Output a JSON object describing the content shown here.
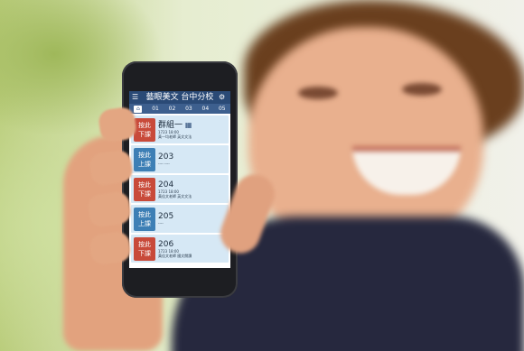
{
  "app": {
    "title": "藝眼美文 台中分校",
    "tabs": [
      "01",
      "02",
      "03",
      "04",
      "05"
    ],
    "rooms": [
      {
        "action_line1": "按此",
        "action_line2": "下課",
        "status": "in-use",
        "room": "群組一",
        "meta_line1": "1723   18:00",
        "meta_line2": "黃一均老師    英文文法"
      },
      {
        "action_line1": "按此",
        "action_line2": "上課",
        "status": "free",
        "room": "203",
        "meta_line1": "----    ----",
        "meta_line2": ""
      },
      {
        "action_line1": "按此",
        "action_line2": "下課",
        "status": "in-use",
        "room": "204",
        "meta_line1": "1723   18:00",
        "meta_line2": "黃佳文老師    英文文法"
      },
      {
        "action_line1": "按此",
        "action_line2": "上課",
        "status": "free",
        "room": "205",
        "meta_line1": "----",
        "meta_line2": ""
      },
      {
        "action_line1": "按此",
        "action_line2": "下課",
        "status": "in-use",
        "room": "206",
        "meta_line1": "1723   18:00",
        "meta_line2": "黃佳文老師    國文閱讀"
      }
    ]
  }
}
